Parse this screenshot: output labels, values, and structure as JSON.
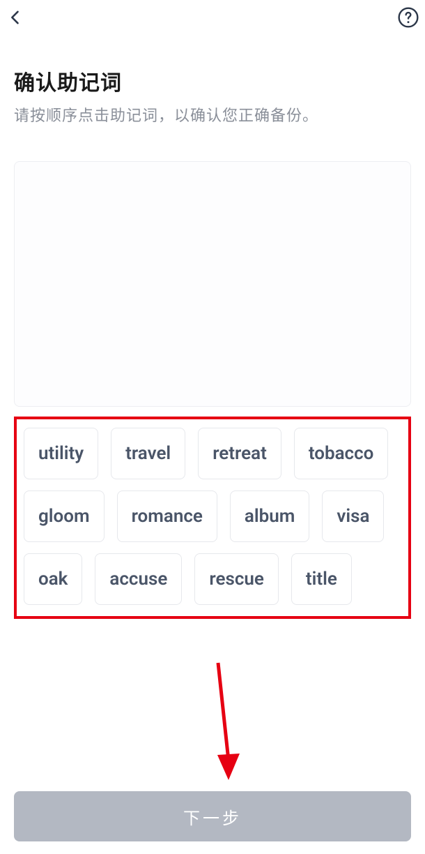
{
  "header": {
    "back_icon": "chevron-left",
    "help_icon": "question-mark-circle"
  },
  "page": {
    "title": "确认助记词",
    "subtitle": "请按顺序点击助记词，以确认您正确备份。"
  },
  "mnemonic_words": [
    "utility",
    "travel",
    "retreat",
    "tobacco",
    "gloom",
    "romance",
    "album",
    "visa",
    "oak",
    "accuse",
    "rescue",
    "title"
  ],
  "button": {
    "next_label": "下一步"
  },
  "annotation_colors": {
    "highlight_border": "#e60012",
    "arrow": "#e60012"
  }
}
